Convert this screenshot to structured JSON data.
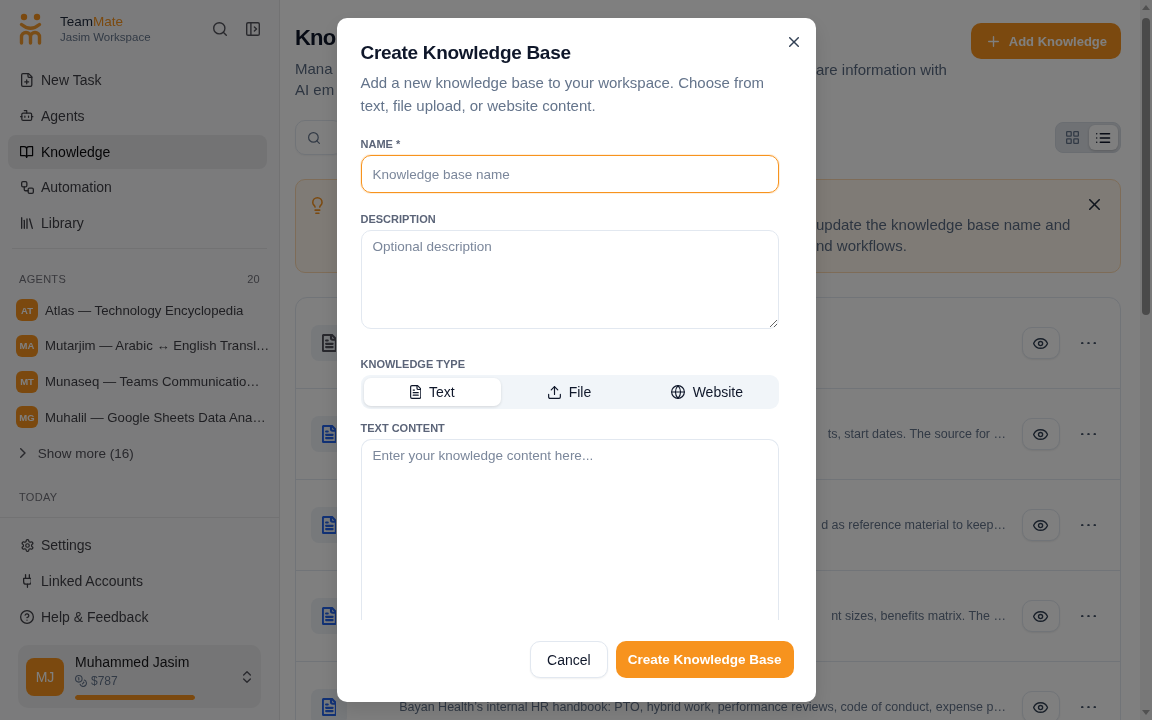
{
  "sidebar": {
    "brand": {
      "name": "Team",
      "accent": "Mate"
    },
    "workspace": "Jasim Workspace",
    "nav": [
      {
        "label": "New Task",
        "selected": false
      },
      {
        "label": "Agents",
        "selected": false
      },
      {
        "label": "Knowledge",
        "selected": true
      },
      {
        "label": "Automation",
        "selected": false
      },
      {
        "label": "Library",
        "selected": false
      }
    ],
    "agents_heading": "AGENTS",
    "agents_count": "20",
    "agents": [
      {
        "initials": "AT",
        "name": "Atlas — Technology Encyclopedia",
        "selected": false
      },
      {
        "initials": "MA",
        "name": "Mutarjim — Arabic ↔ English Transl…",
        "selected": false
      },
      {
        "initials": "MT",
        "name": "Munaseq — Teams Communicatio…",
        "selected": false
      },
      {
        "initials": "MG",
        "name": "Muhalil — Google Sheets Data Ana…",
        "selected": false
      }
    ],
    "show_more": "Show more (16)",
    "today_heading": "TODAY",
    "footer_nav": [
      {
        "label": "Settings",
        "selected": false
      },
      {
        "label": "Linked Accounts",
        "selected": false
      },
      {
        "label": "Help & Feedback",
        "selected": false
      }
    ],
    "user": {
      "initials": "MJ",
      "name": "Muhammed Jasim",
      "credits": "$787",
      "level": 1
    }
  },
  "main": {
    "title": "Kno",
    "subtitle_left": [
      "Mana",
      "AI em"
    ],
    "subtitle_right": [
      "are information with"
    ],
    "add_button": "Add Knowledge",
    "view_modes": [
      {
        "selected": false
      },
      {
        "selected": true
      }
    ],
    "tip_lines": [
      "update the knowledge base name and",
      "nd workflows."
    ],
    "items": [
      {
        "color": "#29292e"
      },
      {
        "color": "#123276",
        "description": "ts, start dates. The source for …"
      },
      {
        "color": "#123276",
        "description": "d as reference material to keep…"
      },
      {
        "color": "#123276",
        "description": "nt sizes, benefits matrix. The …"
      },
      {
        "color": "#123276",
        "description": "Bayan Health’s internal HR handbook: PTO, hybrid work, performance reviews, code of conduct, expense p…"
      }
    ]
  },
  "dialog": {
    "title": "Create Knowledge Base",
    "description": "Add a new knowledge base to your workspace. Choose from text, file upload, or website content.",
    "fields": [
      {
        "kind": "input",
        "label": "NAME *",
        "placeholder": "Knowledge base name",
        "focused": true
      },
      {
        "kind": "textarea",
        "label": "DESCRIPTION",
        "placeholder": "Optional description",
        "focused": false
      }
    ],
    "type_label": "KNOWLEDGE TYPE",
    "types": [
      {
        "label": "Text",
        "selected": true
      },
      {
        "label": "File",
        "selected": false
      },
      {
        "label": "Website",
        "selected": false
      }
    ],
    "content_label": "TEXT CONTENT",
    "content_placeholder": "Enter your knowledge content here...",
    "buttons": [
      {
        "kind": "secondary",
        "label": "Cancel"
      },
      {
        "kind": "primary",
        "label": "Create Knowledge Base"
      }
    ]
  }
}
